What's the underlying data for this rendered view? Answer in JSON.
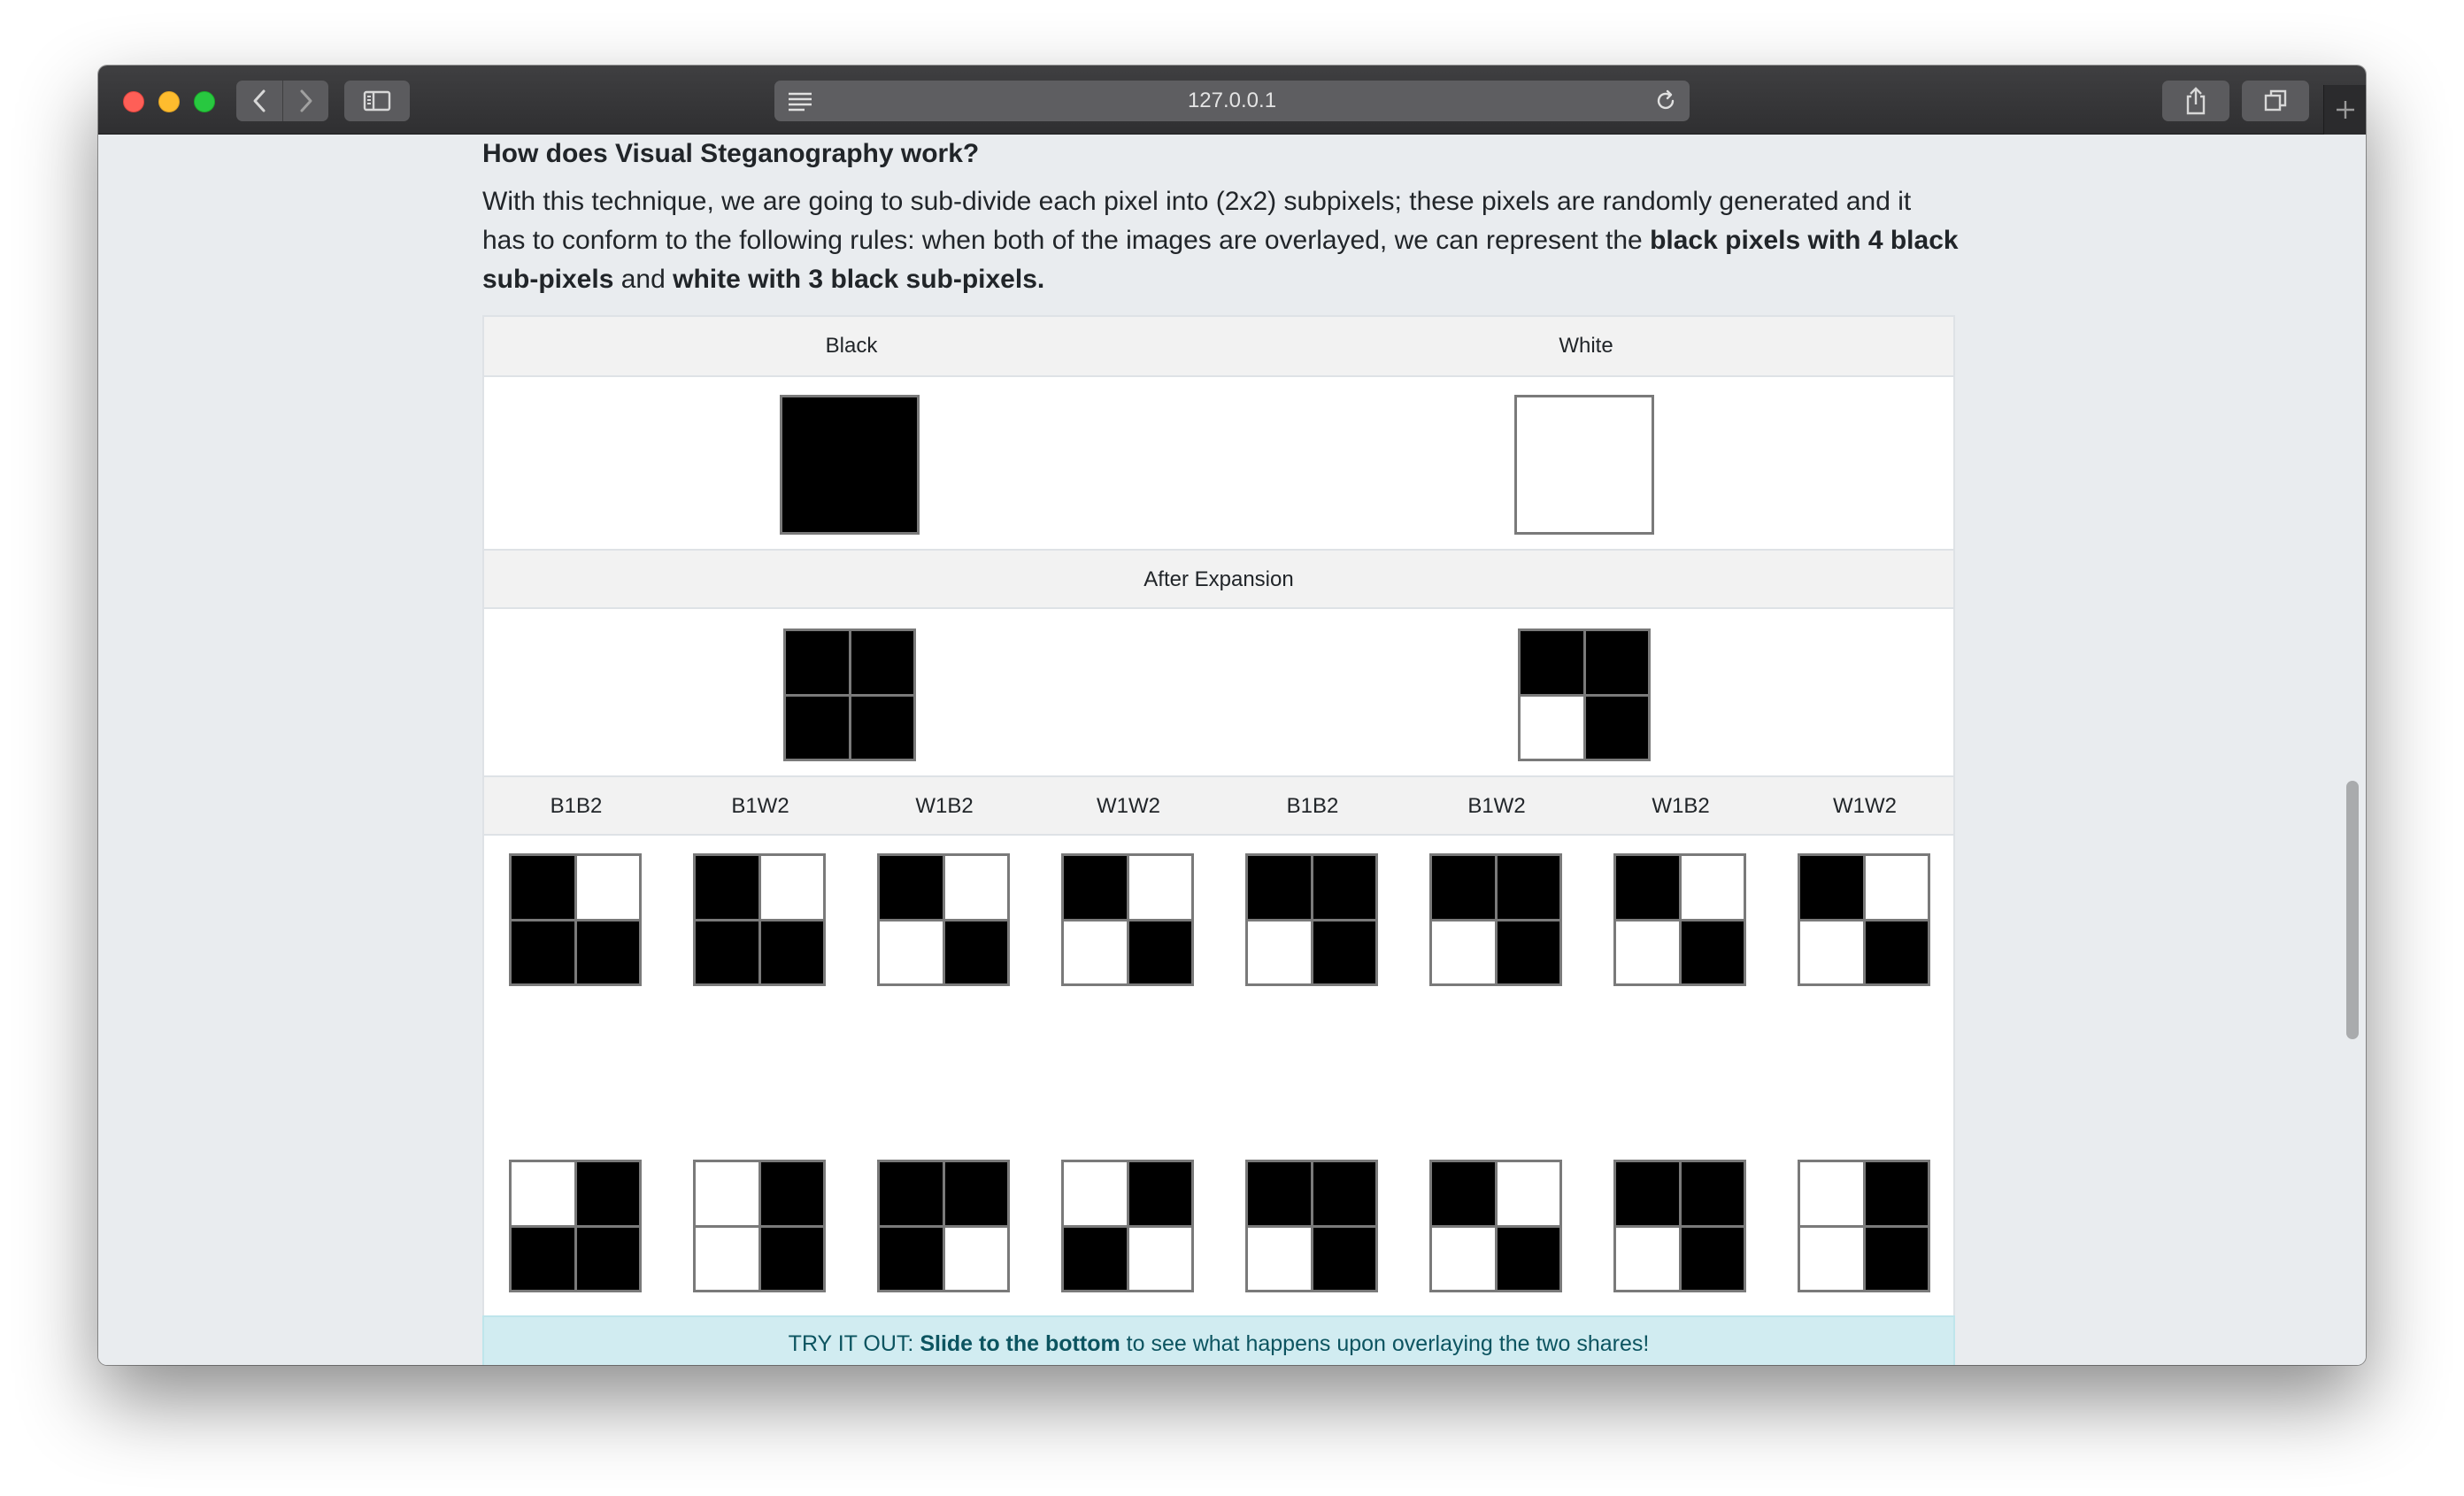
{
  "browser": {
    "url": "127.0.0.1"
  },
  "page": {
    "heading": "How does Visual Steganography work?",
    "intro": {
      "p1": "With this technique, we are going to sub-divide each pixel into (2x2) subpixels; these pixels are randomly generated and it has to conform to the following rules: when both of the images are overlayed, we can represent the ",
      "b1": "black pixels with 4 black sub-pixels",
      "p2": " and ",
      "b2": "white with 3 black sub-pixels."
    },
    "table": {
      "col_black": "Black",
      "col_white": "White",
      "after_expansion": "After Expansion",
      "combo_headers": [
        "B1B2",
        "B1W2",
        "W1B2",
        "W1W2",
        "B1B2",
        "B1W2",
        "W1B2",
        "W1W2"
      ],
      "expanded_black": [
        1,
        1,
        1,
        1
      ],
      "expanded_white": [
        1,
        1,
        0,
        1
      ],
      "share1_patterns": [
        [
          1,
          0,
          1,
          1
        ],
        [
          1,
          0,
          1,
          1
        ],
        [
          1,
          0,
          0,
          1
        ],
        [
          1,
          0,
          0,
          1
        ],
        [
          1,
          1,
          0,
          1
        ],
        [
          1,
          1,
          0,
          1
        ],
        [
          1,
          0,
          0,
          1
        ],
        [
          1,
          0,
          0,
          1
        ]
      ],
      "share2_patterns": [
        [
          0,
          1,
          1,
          1
        ],
        [
          0,
          1,
          0,
          1
        ],
        [
          1,
          1,
          1,
          0
        ],
        [
          0,
          1,
          1,
          0
        ],
        [
          1,
          1,
          0,
          1
        ],
        [
          1,
          0,
          0,
          1
        ],
        [
          1,
          1,
          0,
          1
        ],
        [
          0,
          1,
          0,
          1
        ]
      ]
    },
    "alert": {
      "prefix": "TRY IT OUT: ",
      "bold": "Slide to the bottom",
      "suffix": " to see what happens upon overlaying the two shares!"
    }
  }
}
